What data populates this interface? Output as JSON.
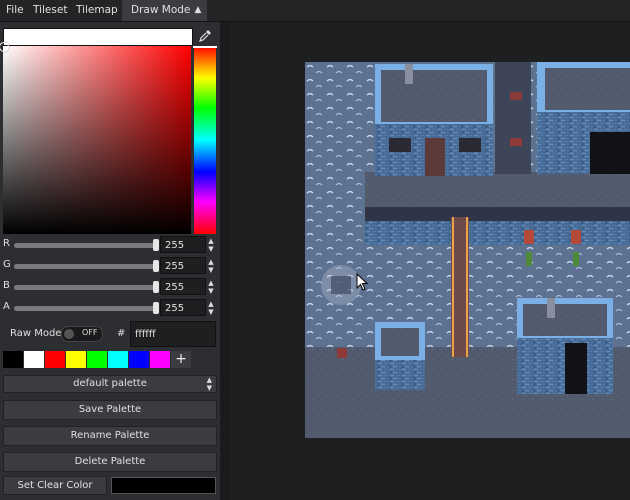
{
  "menu": {
    "file": "File",
    "tileset": "Tileset",
    "tilemap": "Tilemap",
    "draw_mode": "Draw Mode"
  },
  "color_picker": {
    "current_color": "#ffffff",
    "sliders": [
      {
        "label": "R",
        "value": "255",
        "level": 1.0
      },
      {
        "label": "G",
        "value": "255",
        "level": 1.0
      },
      {
        "label": "B",
        "value": "255",
        "level": 1.0
      },
      {
        "label": "A",
        "value": "255",
        "level": 1.0
      }
    ],
    "raw_mode_label": "Raw Mode",
    "raw_mode_state": "OFF",
    "hash": "#",
    "hex_value": "ffffff"
  },
  "palette": {
    "swatches": [
      "#000000",
      "#ffffff",
      "#ff0000",
      "#ffff00",
      "#00ff00",
      "#00ffff",
      "#0000ff",
      "#ff00ff"
    ],
    "selected": "default palette",
    "save_label": "Save Palette",
    "rename_label": "Rename Palette",
    "delete_label": "Delete Palette",
    "clear_color_label": "Set Clear Color",
    "clear_color": "#000000"
  },
  "icons": {
    "eyedropper": "eyedropper-icon",
    "add": "plus-icon",
    "cursor": "mouse-cursor-icon"
  }
}
